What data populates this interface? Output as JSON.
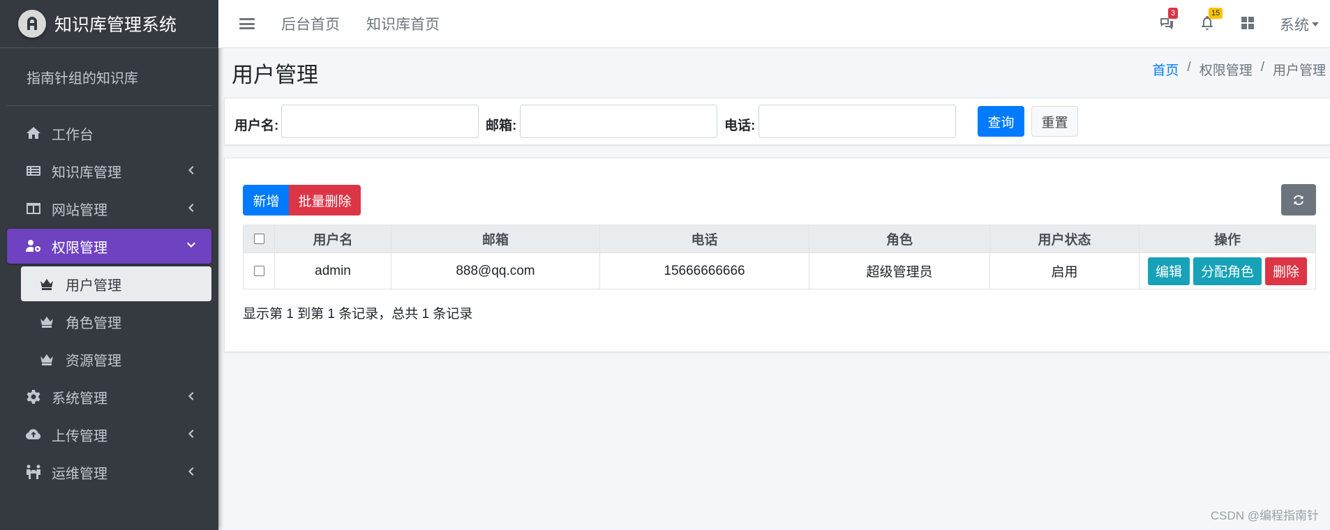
{
  "brand": {
    "title": "知识库管理系统",
    "logo_icon": "brand-logo-icon"
  },
  "user_panel": {
    "name": "指南针组的知识库"
  },
  "sidebar": {
    "items": [
      {
        "label": "工作台",
        "icon": "home-icon"
      },
      {
        "label": "知识库管理",
        "icon": "list-icon"
      },
      {
        "label": "网站管理",
        "icon": "columns-icon"
      },
      {
        "label": "权限管理",
        "icon": "users-cog-icon"
      },
      {
        "label": "用户管理",
        "icon": "crown-icon"
      },
      {
        "label": "角色管理",
        "icon": "crown-icon"
      },
      {
        "label": "资源管理",
        "icon": "crown-icon"
      },
      {
        "label": "系统管理",
        "icon": "gear-icon"
      },
      {
        "label": "上传管理",
        "icon": "cloud-upload-icon"
      },
      {
        "label": "运维管理",
        "icon": "people-carry-icon"
      }
    ]
  },
  "topbar": {
    "links": [
      "后台首页",
      "知识库首页"
    ],
    "messages_badge": "3",
    "notifications_badge": "15",
    "system_label": "系统"
  },
  "page": {
    "title": "用户管理",
    "breadcrumb": [
      "首页",
      "权限管理",
      "用户管理"
    ]
  },
  "search": {
    "username_label": "用户名:",
    "email_label": "邮箱:",
    "phone_label": "电话:",
    "username_value": "",
    "email_value": "",
    "phone_value": "",
    "query_label": "查询",
    "reset_label": "重置"
  },
  "toolbar": {
    "add_label": "新增",
    "batch_delete_label": "批量删除"
  },
  "table": {
    "headers": [
      "用户名",
      "邮箱",
      "电话",
      "角色",
      "用户状态",
      "操作"
    ],
    "rows": [
      {
        "username": "admin",
        "email": "888@qq.com",
        "phone": "15666666666",
        "role": "超级管理员",
        "status": "启用"
      }
    ],
    "actions": {
      "edit": "编辑",
      "assign_role": "分配角色",
      "delete": "删除"
    }
  },
  "pagination": {
    "summary": "显示第 1 到第 1 条记录，总共 1 条记录"
  },
  "watermark": "CSDN @编程指南针",
  "colors": {
    "accent": "#6f42c1",
    "primary": "#007bff",
    "danger": "#dc3545",
    "info": "#17a2b8",
    "sidebar": "#343a40"
  }
}
